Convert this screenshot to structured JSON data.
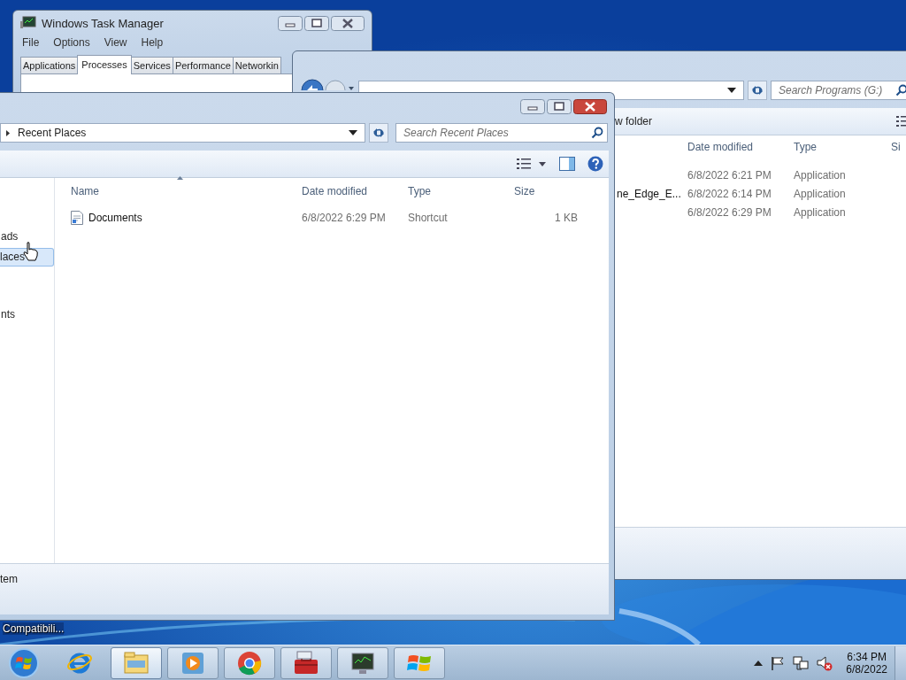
{
  "desktop": {
    "icon_label": "Compatibili..."
  },
  "task_manager": {
    "title": "Windows Task Manager",
    "menu": [
      "File",
      "Options",
      "View",
      "Help"
    ],
    "tabs": [
      {
        "label": "Applications",
        "selected": false
      },
      {
        "label": "Processes",
        "selected": true
      },
      {
        "label": "Services",
        "selected": false
      },
      {
        "label": "Performance",
        "selected": false
      },
      {
        "label": "Networkin",
        "selected": false
      }
    ]
  },
  "back_explorer": {
    "search": {
      "placeholder": "Search Programs (G:)"
    },
    "toolbar": [
      "w folder"
    ],
    "columns": [
      "Date modified",
      "Type",
      "Si"
    ],
    "rows": [
      {
        "date": "6/8/2022 6:21 PM",
        "type": "Application"
      },
      {
        "name": "ne_Edge_E...",
        "date": "6/8/2022 6:14 PM",
        "type": "Application"
      },
      {
        "date": "6/8/2022 6:29 PM",
        "type": "Application"
      }
    ]
  },
  "front_explorer": {
    "address": "Recent Places",
    "search": {
      "placeholder": "Search Recent Places"
    },
    "columns": [
      "Name",
      "Date modified",
      "Type",
      "Size"
    ],
    "rows": [
      {
        "name": "Documents",
        "date": "6/8/2022 6:29 PM",
        "type": "Shortcut",
        "size": "1 KB"
      }
    ],
    "sidebar": [
      {
        "label": "ads",
        "selected": false
      },
      {
        "label": "laces",
        "selected": true
      },
      {
        "label": "nts",
        "selected": false
      }
    ],
    "status": "tem"
  },
  "taskbar": {
    "items": [
      {
        "kind": "ie",
        "running": false,
        "selected": false
      },
      {
        "kind": "explorer",
        "running": true,
        "selected": true
      },
      {
        "kind": "media",
        "running": true,
        "selected": false
      },
      {
        "kind": "chrome",
        "running": true,
        "selected": false
      },
      {
        "kind": "toolbox",
        "running": true,
        "selected": false
      },
      {
        "kind": "monitor",
        "running": true,
        "selected": false
      },
      {
        "kind": "windows",
        "running": true,
        "selected": false
      }
    ],
    "clock": {
      "time": "6:34 PM",
      "date": "6/8/2022"
    }
  }
}
